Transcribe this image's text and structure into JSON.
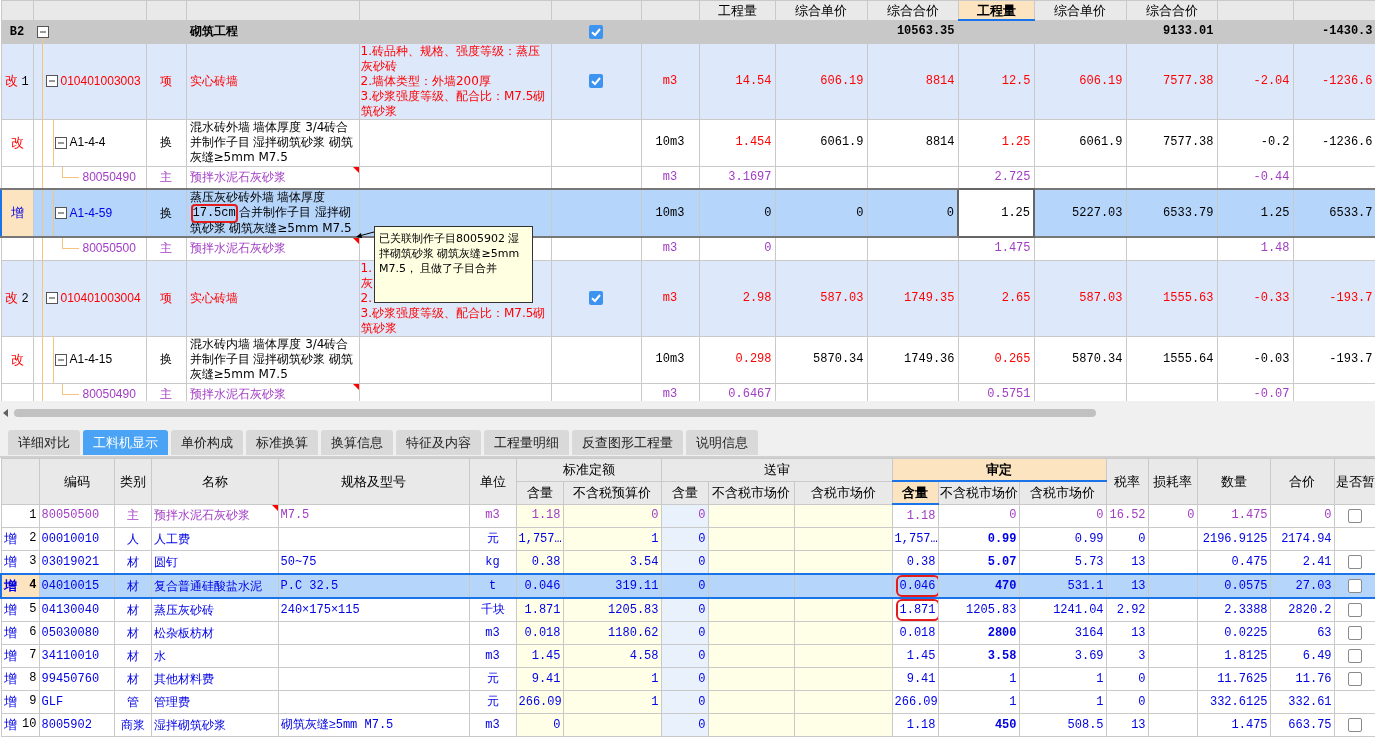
{
  "top_table": {
    "headers": [
      {
        "label": "工程量",
        "selected": false
      },
      {
        "label": "综合单价",
        "selected": false
      },
      {
        "label": "综合合价",
        "selected": false
      },
      {
        "label": "工程量",
        "selected": true
      },
      {
        "label": "综合单价",
        "selected": false
      },
      {
        "label": "综合合价",
        "selected": false
      }
    ],
    "rows": [
      {
        "kind": "group",
        "code_label": "B2",
        "name": "砌筑工程",
        "checked": true,
        "selected": false,
        "total": "10563.35",
        "aud_total": "9133.01",
        "price_diff": "-1430.3"
      },
      {
        "kind": "item",
        "added": false,
        "mark": "改",
        "number": "1",
        "code": "010401003003",
        "type": "项",
        "name": "实心砖墙",
        "features": [
          "1.砖品种、规格、强度等级：蒸压灰砂砖",
          "2.墙体类型：外墙200厚",
          "3.砂浆强度等级、配合比：M7.5砌筑砂浆"
        ],
        "checked": true,
        "unit": "m3",
        "selected": false,
        "qty": "14.54",
        "price": "606.19",
        "total": "8814",
        "aud_qty": "12.5",
        "aud_price": "606.19",
        "aud_total": "7577.38",
        "qty_diff": "-2.04",
        "price_diff": "-1236.6"
      },
      {
        "kind": "sub",
        "added": false,
        "mark": "改",
        "code": "A1-4-4",
        "type": "换",
        "name": [
          {
            "text": "混水砖外墙 墙体厚度 3/4砖合并制作子目 湿拌砌筑砂浆 砌筑灰缝≥5mm M7.5",
            "boxed": false
          }
        ],
        "unit": "10m3",
        "selected": false,
        "qty": "1.454",
        "price": "6061.9",
        "total": "8814",
        "aud_qty": "1.25",
        "aud_price": "6061.9",
        "aud_total": "7577.38",
        "qty_diff": "-0.2",
        "price_diff": "-1236.6"
      },
      {
        "kind": "material",
        "code": "80050490",
        "type": "主",
        "name": "预拌水泥石灰砂浆",
        "note": true,
        "unit": "m3",
        "selected": false,
        "qty": "3.1697",
        "aud_qty": "2.725",
        "qty_diff": "-0.44"
      },
      {
        "kind": "sub",
        "added": true,
        "mark": "增",
        "code": "A1-4-59",
        "type": "换",
        "name": [
          {
            "text": "蒸压灰砂砖外墙 墙体厚度",
            "boxed": false
          },
          {
            "text": "17.5cm",
            "boxed": true
          },
          {
            "text": "合并制作子目 湿拌砌筑砂浆 砌筑灰缝≥5mm M7.5",
            "boxed": false
          }
        ],
        "unit": "10m3",
        "selected": true,
        "qty": "0",
        "price": "0",
        "total": "0",
        "aud_qty": "1.25",
        "aud_price": "5227.03",
        "aud_total": "6533.79",
        "qty_diff": "1.25",
        "price_diff": "6533.7"
      },
      {
        "kind": "material",
        "code": "80050500",
        "type": "主",
        "name": "预拌水泥石灰砂浆",
        "note": true,
        "unit": "m3",
        "selected": false,
        "qty": "0",
        "aud_qty": "1.475",
        "qty_diff": "1.48"
      },
      {
        "kind": "item",
        "added": false,
        "mark": "改",
        "number": "2",
        "code": "010401003004",
        "type": "项",
        "name": "实心砖墙",
        "features": [
          "1.",
          "灰",
          "2.",
          "3.砂浆强度等级、配合比：M7.5砌筑砂浆"
        ],
        "checked": true,
        "unit": "m3",
        "selected": false,
        "qty": "2.98",
        "price": "587.03",
        "total": "1749.35",
        "aud_qty": "2.65",
        "aud_price": "587.03",
        "aud_total": "1555.63",
        "qty_diff": "-0.33",
        "price_diff": "-193.7"
      },
      {
        "kind": "sub",
        "added": false,
        "mark": "改",
        "code": "A1-4-15",
        "type": "换",
        "name": [
          {
            "text": "混水砖内墙 墙体厚度 3/4砖合并制作子目 湿拌砌筑砂浆 砌筑灰缝≥5mm M7.5",
            "boxed": false
          }
        ],
        "unit": "10m3",
        "selected": false,
        "qty": "0.298",
        "price": "5870.34",
        "total": "1749.36",
        "aud_qty": "0.265",
        "aud_price": "5870.34",
        "aud_total": "1555.64",
        "qty_diff": "-0.03",
        "price_diff": "-193.7"
      },
      {
        "kind": "material",
        "code": "80050490",
        "type": "主",
        "name": "预拌水泥石灰砂浆",
        "note": true,
        "unit": "m3",
        "selected": false,
        "qty": "0.6467",
        "aud_qty": "0.5751",
        "qty_diff": "-0.07"
      }
    ],
    "tooltip": "已关联制作子目8005902 湿拌砌筑砂浆 砌筑灰缝≥5mm M7.5， 且做了子目合并"
  },
  "tabs": [
    {
      "label": "详细对比",
      "selected": false
    },
    {
      "label": "工料机显示",
      "selected": true
    },
    {
      "label": "单价构成",
      "selected": false
    },
    {
      "label": "标准换算",
      "selected": false
    },
    {
      "label": "换算信息",
      "selected": false
    },
    {
      "label": "特征及内容",
      "selected": false
    },
    {
      "label": "工程量明细",
      "selected": false
    },
    {
      "label": "反查图形工程量",
      "selected": false
    },
    {
      "label": "说明信息",
      "selected": false
    }
  ],
  "bottom_table": {
    "headers": [
      {
        "label": "编码"
      },
      {
        "label": "类别"
      },
      {
        "label": "名称"
      },
      {
        "label": "规格及型号"
      },
      {
        "label": "单位"
      },
      {
        "label": "标准定额",
        "selected": false,
        "sub": [
          {
            "label": "含量",
            "selected": false
          },
          {
            "label": "不含税预算价",
            "selected": false
          }
        ]
      },
      {
        "label": "送审",
        "selected": false,
        "sub": [
          {
            "label": "含量",
            "selected": false
          },
          {
            "label": "不含税市场价",
            "selected": false
          },
          {
            "label": "含税市场价",
            "selected": false
          }
        ]
      },
      {
        "label": "审定",
        "selected": true,
        "sub": [
          {
            "label": "含量",
            "selected": true
          },
          {
            "label": "不含税市场价",
            "selected": false
          },
          {
            "label": "含税市场价",
            "selected": false
          }
        ]
      },
      {
        "label": "税率"
      },
      {
        "label": "损耗率"
      },
      {
        "label": "数量"
      },
      {
        "label": "合价"
      },
      {
        "label": "是否暂"
      }
    ],
    "rows": [
      {
        "kind": "main",
        "number": "1",
        "code": "80050500",
        "type": "主",
        "name": "预拌水泥石灰砂浆",
        "note": true,
        "spec": "M7.5",
        "unit": "m3",
        "selected": false,
        "price_bold": false,
        "qty_boxed": false,
        "provisional": false,
        "std_qty": "1.18",
        "std_price": "0",
        "sub_qty": "0",
        "aud_qty": "1.18",
        "aud_price": "0",
        "aud_tax_price": "0",
        "tax_rate": "16.52",
        "loss_rate": "0",
        "amount": "1.475",
        "total": "0"
      },
      {
        "kind": "normal",
        "added": true,
        "mark": "增",
        "number": "2",
        "code": "00010010",
        "type": "人",
        "name": "人工费",
        "unit": "元",
        "selected": false,
        "price_bold": true,
        "qty_boxed": false,
        "std_qty": "1,757…",
        "std_price": "1",
        "sub_qty": "0",
        "aud_qty": "1,757…",
        "aud_price": "0.99",
        "aud_tax_price": "0.99",
        "tax_rate": "0",
        "amount": "2196.9125",
        "total": "2174.94"
      },
      {
        "kind": "normal",
        "added": true,
        "mark": "增",
        "number": "3",
        "code": "03019021",
        "type": "材",
        "name": "圆钉",
        "spec": "50~75",
        "unit": "kg",
        "selected": false,
        "price_bold": true,
        "qty_boxed": false,
        "provisional": false,
        "std_qty": "0.38",
        "std_price": "3.54",
        "sub_qty": "0",
        "aud_qty": "0.38",
        "aud_price": "5.07",
        "aud_tax_price": "5.73",
        "tax_rate": "13",
        "amount": "0.475",
        "total": "2.41"
      },
      {
        "kind": "normal",
        "added": true,
        "mark": "增",
        "number": "4",
        "code": "04010015",
        "type": "材",
        "name": "复合普通硅酸盐水泥",
        "spec": "P.C 32.5",
        "unit": "t",
        "selected": true,
        "price_bold": true,
        "qty_boxed": true,
        "provisional": false,
        "std_qty": "0.046",
        "std_price": "319.11",
        "sub_qty": "0",
        "aud_qty": "0.046",
        "aud_price": "470",
        "aud_tax_price": "531.1",
        "tax_rate": "13",
        "amount": "0.0575",
        "total": "27.03"
      },
      {
        "kind": "normal",
        "added": true,
        "mark": "增",
        "number": "5",
        "code": "04130040",
        "type": "材",
        "name": "蒸压灰砂砖",
        "spec": "240×175×115",
        "unit": "千块",
        "selected": false,
        "price_bold": false,
        "qty_boxed": true,
        "provisional": false,
        "std_qty": "1.871",
        "std_price": "1205.83",
        "sub_qty": "0",
        "aud_qty": "1.871",
        "aud_price": "1205.83",
        "aud_tax_price": "1241.04",
        "tax_rate": "2.92",
        "amount": "2.3388",
        "total": "2820.2"
      },
      {
        "kind": "normal",
        "added": true,
        "mark": "增",
        "number": "6",
        "code": "05030080",
        "type": "材",
        "name": "松杂板枋材",
        "unit": "m3",
        "selected": false,
        "price_bold": true,
        "qty_boxed": false,
        "provisional": false,
        "std_qty": "0.018",
        "std_price": "1180.62",
        "sub_qty": "0",
        "aud_qty": "0.018",
        "aud_price": "2800",
        "aud_tax_price": "3164",
        "tax_rate": "13",
        "amount": "0.0225",
        "total": "63"
      },
      {
        "kind": "normal",
        "added": true,
        "mark": "增",
        "number": "7",
        "code": "34110010",
        "type": "材",
        "name": "水",
        "unit": "m3",
        "selected": false,
        "price_bold": true,
        "qty_boxed": false,
        "provisional": false,
        "std_qty": "1.45",
        "std_price": "4.58",
        "sub_qty": "0",
        "aud_qty": "1.45",
        "aud_price": "3.58",
        "aud_tax_price": "3.69",
        "tax_rate": "3",
        "amount": "1.8125",
        "total": "6.49"
      },
      {
        "kind": "normal",
        "added": true,
        "mark": "增",
        "number": "8",
        "code": "99450760",
        "type": "材",
        "name": "其他材料费",
        "unit": "元",
        "selected": false,
        "price_bold": false,
        "qty_boxed": false,
        "provisional": false,
        "std_qty": "9.41",
        "std_price": "1",
        "sub_qty": "0",
        "aud_qty": "9.41",
        "aud_price": "1",
        "aud_tax_price": "1",
        "tax_rate": "0",
        "amount": "11.7625",
        "total": "11.76"
      },
      {
        "kind": "normal",
        "added": true,
        "mark": "增",
        "number": "9",
        "code": "GLF",
        "type": "管",
        "name": "管理费",
        "unit": "元",
        "selected": false,
        "price_bold": false,
        "qty_boxed": false,
        "std_qty": "266.09",
        "std_price": "1",
        "sub_qty": "0",
        "aud_qty": "266.09",
        "aud_price": "1",
        "aud_tax_price": "1",
        "tax_rate": "0",
        "amount": "332.6125",
        "total": "332.61"
      },
      {
        "kind": "normal",
        "added": true,
        "mark": "增",
        "number": "10",
        "code": "8005902",
        "type": "商浆",
        "name": "湿拌砌筑砂浆",
        "spec": "砌筑灰缝≥5mm M7.5",
        "unit": "m3",
        "selected": false,
        "price_bold": true,
        "qty_boxed": false,
        "provisional": false,
        "std_qty": "0",
        "sub_qty": "0",
        "aud_qty": "1.18",
        "aud_price": "450",
        "aud_tax_price": "508.5",
        "tax_rate": "13",
        "amount": "1.475",
        "total": "663.75"
      }
    ]
  }
}
